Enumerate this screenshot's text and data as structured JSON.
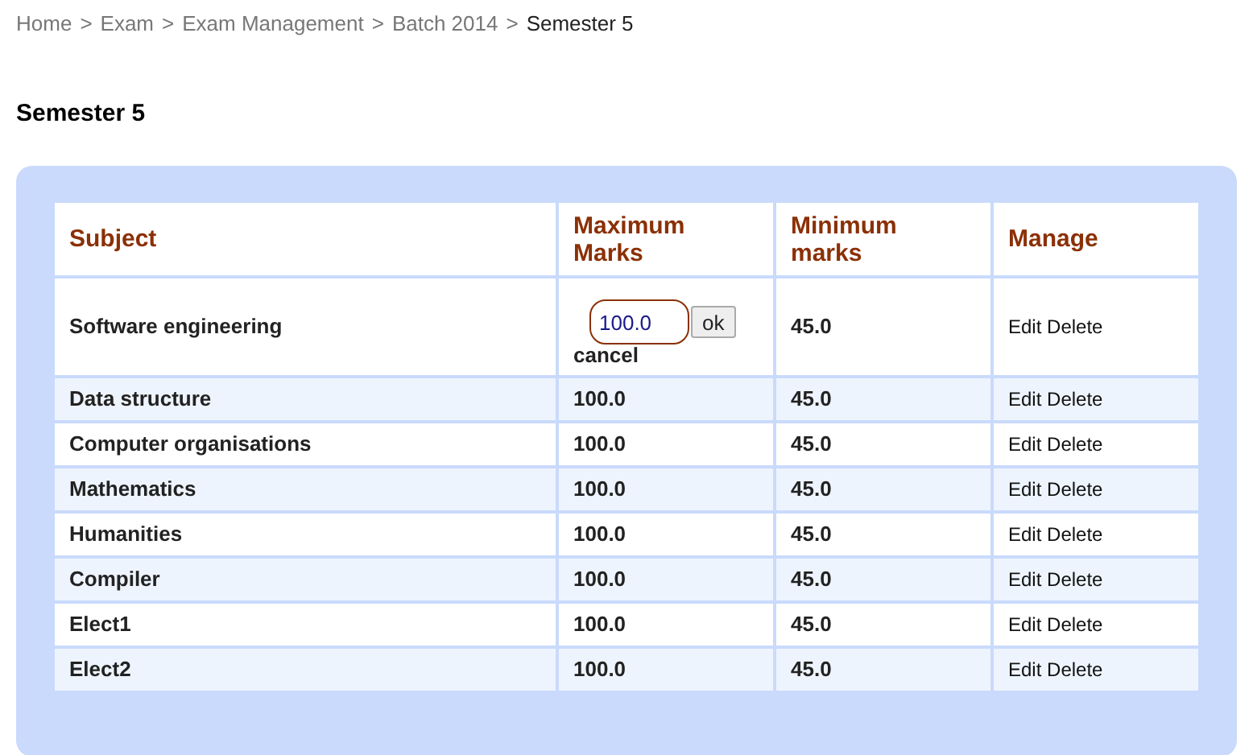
{
  "breadcrumb": {
    "separator": ">",
    "items": [
      {
        "label": "Home",
        "current": false
      },
      {
        "label": "Exam",
        "current": false
      },
      {
        "label": "Exam Management",
        "current": false
      },
      {
        "label": "Batch 2014",
        "current": false
      },
      {
        "label": "Semester 5",
        "current": true
      }
    ]
  },
  "title": "Semester 5",
  "table": {
    "columns": [
      "Subject",
      "Maximum Marks",
      "Minimum marks",
      "Manage"
    ],
    "rows": [
      {
        "subject": "Software engineering",
        "editing": true,
        "max_marks": "100.0",
        "ok": "ok",
        "cancel": "cancel",
        "min_marks": "45.0",
        "edit": "Edit",
        "delete": "Delete"
      },
      {
        "subject": "Data structure",
        "editing": false,
        "max_marks": "100.0",
        "min_marks": "45.0",
        "edit": "Edit",
        "delete": "Delete"
      },
      {
        "subject": "Computer organisations",
        "editing": false,
        "max_marks": "100.0",
        "min_marks": "45.0",
        "edit": "Edit",
        "delete": "Delete"
      },
      {
        "subject": "Mathematics",
        "editing": false,
        "max_marks": "100.0",
        "min_marks": "45.0",
        "edit": "Edit",
        "delete": "Delete"
      },
      {
        "subject": "Humanities",
        "editing": false,
        "max_marks": "100.0",
        "min_marks": "45.0",
        "edit": "Edit",
        "delete": "Delete"
      },
      {
        "subject": "Compiler",
        "editing": false,
        "max_marks": "100.0",
        "min_marks": "45.0",
        "edit": "Edit",
        "delete": "Delete"
      },
      {
        "subject": "Elect1",
        "editing": false,
        "max_marks": "100.0",
        "min_marks": "45.0",
        "edit": "Edit",
        "delete": "Delete"
      },
      {
        "subject": "Elect2",
        "editing": false,
        "max_marks": "100.0",
        "min_marks": "45.0",
        "edit": "Edit",
        "delete": "Delete"
      }
    ]
  }
}
